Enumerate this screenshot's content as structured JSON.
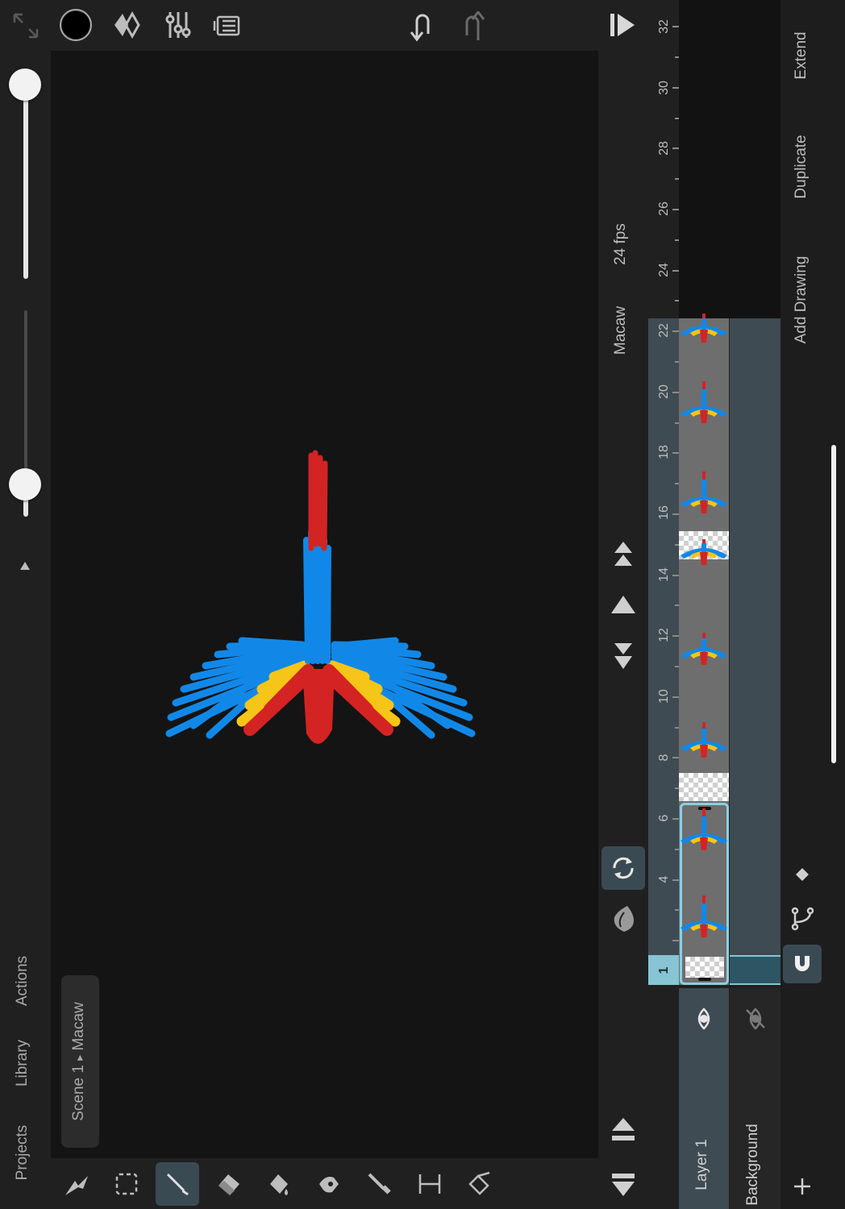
{
  "top_toolbar": {
    "icons": [
      "expand-icon",
      "color-swatch",
      "onion-diamond-icon",
      "sliders-icon",
      "layers-stack-icon",
      "undo-icon",
      "redo-icon",
      "play-icon"
    ],
    "color_swatch": "#000000"
  },
  "left_panel": {
    "menu": [
      "Projects",
      "Library",
      "Actions"
    ],
    "size_slider_value": 1.0,
    "opacity_slider_value": 0.15
  },
  "breadcrumb": {
    "scene": "Scene 1",
    "separator": "▸",
    "project": "Macaw"
  },
  "bottom_tools": [
    "arrow-tool-icon",
    "marquee-select-icon",
    "brush-tool-icon",
    "eraser-tool-icon",
    "fill-bucket-icon",
    "smudge-tool-icon",
    "eyedropper-icon",
    "text-tool-icon",
    "pen-tool-icon"
  ],
  "timeline": {
    "title": "Macaw",
    "fps": "24 fps",
    "frame_numbers": [
      "1",
      "4",
      "6",
      "8",
      "10",
      "12",
      "14",
      "16",
      "18",
      "20",
      "22",
      "24",
      "26",
      "28",
      "30",
      "32"
    ],
    "current_frame": "1",
    "layers": [
      {
        "name": "Layer 1",
        "visible": true
      },
      {
        "name": "Background",
        "visible": false
      }
    ],
    "actions": [
      "Add Drawing",
      "Duplicate",
      "Extend"
    ]
  },
  "colors": {
    "accent": "#87c4d4",
    "macaw_red": "#d42323",
    "macaw_blue": "#1188e8",
    "macaw_yellow": "#f5c518"
  }
}
